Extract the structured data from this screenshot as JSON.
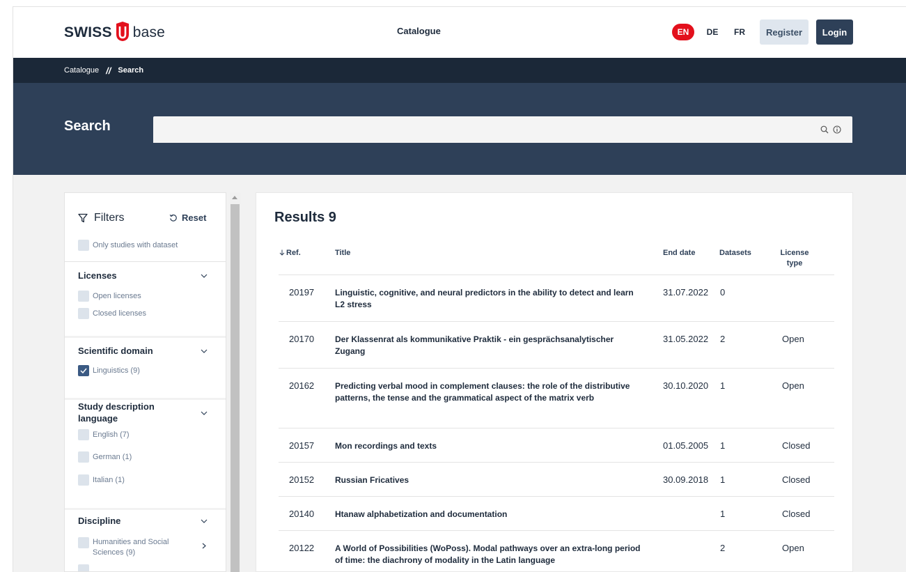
{
  "header": {
    "logo_left": "SWISS",
    "logo_right": "base",
    "nav_catalogue": "Catalogue",
    "languages": [
      "EN",
      "DE",
      "FR"
    ],
    "active_language": "EN",
    "register_label": "Register",
    "login_label": "Login"
  },
  "breadcrumb": {
    "items": [
      "Catalogue",
      "Search"
    ],
    "separator": "//"
  },
  "search": {
    "title": "Search",
    "value": "",
    "placeholder": ""
  },
  "filters": {
    "title": "Filters",
    "reset_label": "Reset",
    "only_with_dataset": {
      "label": "Only studies with dataset",
      "checked": false
    },
    "sections": [
      {
        "title": "Licenses",
        "options": [
          {
            "label": "Open licenses",
            "checked": false
          },
          {
            "label": "Closed licenses",
            "checked": false
          }
        ]
      },
      {
        "title": "Scientific domain",
        "options": [
          {
            "label": "Linguistics (9)",
            "checked": true
          }
        ]
      },
      {
        "title": "Study description language",
        "options": [
          {
            "label": "English (7)",
            "checked": false
          },
          {
            "label": "German (1)",
            "checked": false
          },
          {
            "label": "Italian (1)",
            "checked": false
          }
        ]
      },
      {
        "title": "Discipline",
        "options": [
          {
            "label": "Humanities and Social Sciences (9)",
            "checked": false
          }
        ]
      }
    ]
  },
  "results": {
    "title": "Results 9",
    "columns": {
      "ref": "Ref.",
      "title": "Title",
      "end_date": "End date",
      "datasets": "Datasets",
      "license_type": "License type"
    },
    "sort_icon": "arrow-down-icon",
    "rows": [
      {
        "ref": "20197",
        "title": "Linguistic, cognitive, and neural predictors in the ability to detect and learn L2 stress",
        "end_date": "31.07.2022",
        "datasets": "0",
        "license": ""
      },
      {
        "ref": "20170",
        "title": "Der Klassenrat als kommunikative Praktik - ein gesprächsanalytischer Zugang",
        "end_date": "31.05.2022",
        "datasets": "2",
        "license": "Open"
      },
      {
        "ref": "20162",
        "title": "Predicting verbal mood in complement clauses: the role of the distributive patterns, the tense and the grammatical aspect of the matrix verb",
        "end_date": "30.10.2020",
        "datasets": "1",
        "license": "Open"
      },
      {
        "ref": "20157",
        "title": "Mon recordings and texts",
        "end_date": "01.05.2005",
        "datasets": "1",
        "license": "Closed"
      },
      {
        "ref": "20152",
        "title": "Russian Fricatives",
        "end_date": "30.09.2018",
        "datasets": "1",
        "license": "Closed"
      },
      {
        "ref": "20140",
        "title": "Htanaw alphabetization and documentation",
        "end_date": "",
        "datasets": "1",
        "license": "Closed"
      },
      {
        "ref": "20122",
        "title": "A World of Possibilities (WoPoss). Modal pathways over an extra-long period of time: the diachrony of modality in the Latin language",
        "end_date": "",
        "datasets": "2",
        "license": "Open"
      }
    ]
  },
  "colors": {
    "brand_red": "#e3101c",
    "navy": "#2e4058",
    "dark_navy": "#1b2838",
    "checkbox": "#dce3eb",
    "checkbox_checked": "#3b5a83"
  }
}
